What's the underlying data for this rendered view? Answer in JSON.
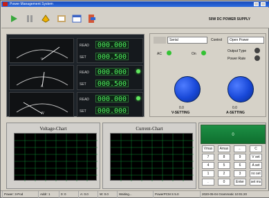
{
  "title": "Power Management System",
  "product_label": "50W DC POWER SUPPLY",
  "toolbar": {
    "icons": [
      "play-icon",
      "pause-icon",
      "connect-icon",
      "settings-icon",
      "window-icon",
      "exit-icon"
    ]
  },
  "meters": [
    {
      "read": "000.000",
      "set": "000.500",
      "unit": "V"
    },
    {
      "read": "000.000",
      "set": "000.500",
      "unit": "A"
    },
    {
      "read": "000.000",
      "set": "000.000",
      "unit": "W"
    }
  ],
  "labels": {
    "read": "READ",
    "set": "SET"
  },
  "right": {
    "mode_value": "Serial",
    "control_label": "Control",
    "control_value": "Open Power",
    "output_type_label": "Output Type",
    "power_state_label": "Power Rate",
    "led_labels": [
      "AC",
      "On"
    ],
    "v_setting": "V-SETTING",
    "a_setting": "A-SETTING",
    "v_value": "0.0",
    "a_value": "0.0"
  },
  "charts": [
    {
      "title": "Voltage-Chart"
    },
    {
      "title": "Current-Chart"
    }
  ],
  "keypad": {
    "display_value": "0",
    "keys": [
      [
        "Vmax",
        "Amax",
        "←",
        "C"
      ],
      [
        "7",
        "8",
        "9",
        "V set"
      ],
      [
        "4",
        "5",
        "6",
        "A set"
      ],
      [
        "1",
        "2",
        "3",
        "no set"
      ],
      [
        ".",
        "0",
        "Enter",
        "set ms"
      ]
    ]
  },
  "status": {
    "items": [
      "Power: 3-Pod",
      "Addr: 1",
      "0: 0",
      "A: 0.0",
      "W: 0.0",
      "Waiting...",
      "PowerPCM S 5.0",
      "2020-05-04 Grammatic 10:01:20"
    ]
  },
  "colors": {
    "accent": "#1f57c4",
    "digit": "#4ef15d",
    "knob": "#1848d8",
    "display": "#0f6f2f"
  }
}
